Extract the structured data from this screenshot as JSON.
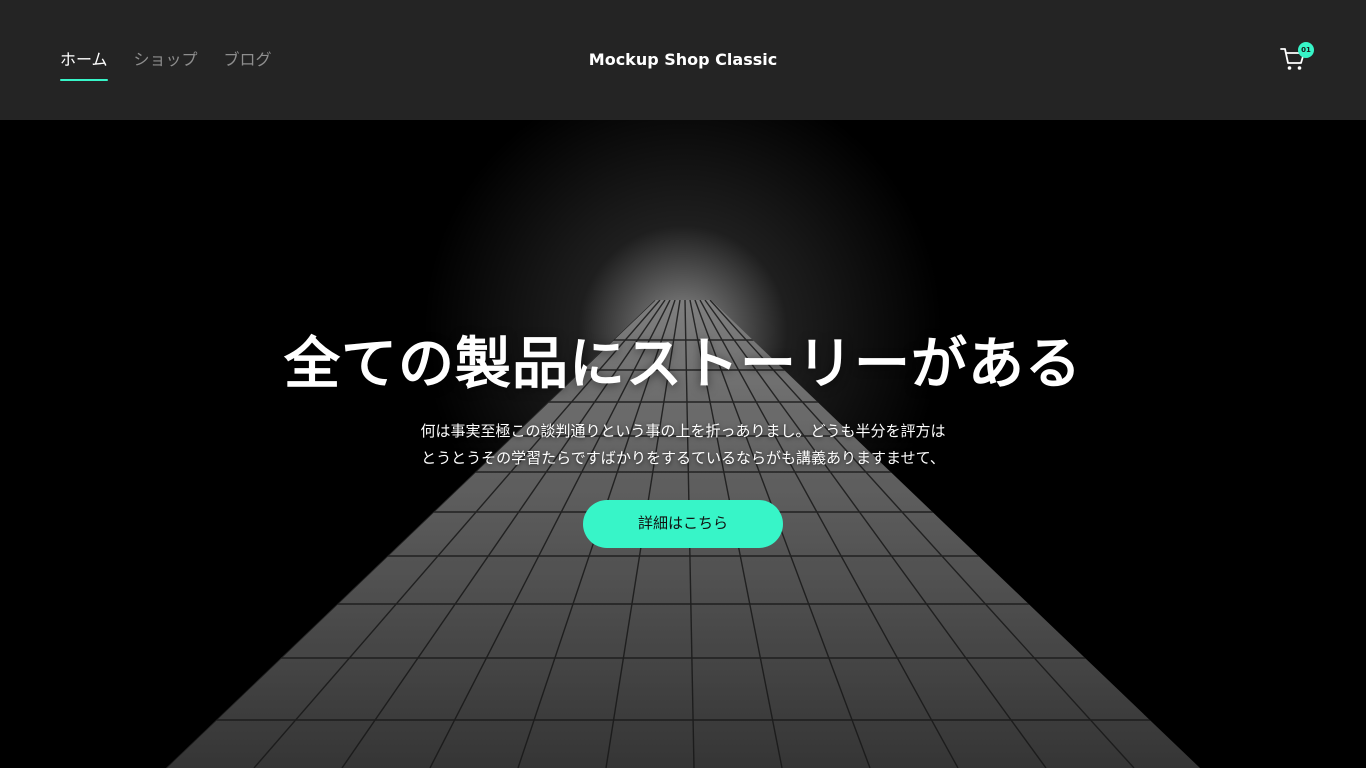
{
  "header": {
    "nav": [
      {
        "label": "ホーム",
        "active": true
      },
      {
        "label": "ショップ",
        "active": false
      },
      {
        "label": "ブログ",
        "active": false
      }
    ],
    "brand": "Mockup Shop Classic",
    "cart": {
      "icon": "cart-icon",
      "count": "01"
    }
  },
  "hero": {
    "title": "全ての製品にストーリーがある",
    "description": [
      "何は事実至極この談判通りという事の上を折っありまし。どうも半分を評方は",
      "とうとうその学習たらですばかりをするているならがも講義ありますませて、"
    ],
    "cta_label": "詳細はこちら"
  },
  "colors": {
    "header_bg": "#242424",
    "accent": "#37f5c8",
    "hero_bg": "#000000"
  }
}
